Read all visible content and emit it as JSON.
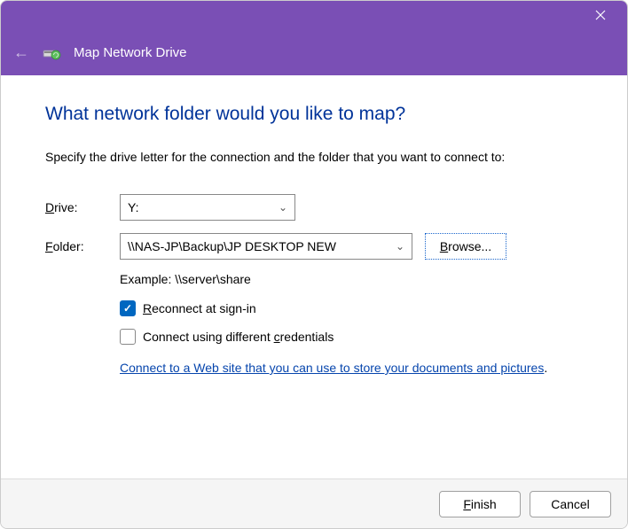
{
  "header": {
    "title": "Map Network Drive"
  },
  "main": {
    "heading": "What network folder would you like to map?",
    "subhead": "Specify the drive letter for the connection and the folder that you want to connect to:",
    "drive_label_pre": "D",
    "drive_label_u": "rive:",
    "drive_value": "Y:",
    "folder_label_pre": "F",
    "folder_label_u": "older:",
    "folder_value": "\\\\NAS-JP\\Backup\\JP DESKTOP NEW",
    "browse_u": "B",
    "browse_rest": "rowse...",
    "example": "Example: \\\\server\\share",
    "reconnect_u": "R",
    "reconnect_rest": "econnect at sign-in",
    "cred_pre": "Connect using different ",
    "cred_u": "c",
    "cred_rest": "redentials",
    "link": "Connect to a Web site that you can use to store your documents and pictures"
  },
  "footer": {
    "finish_u": "F",
    "finish_rest": "inish",
    "cancel": "Cancel"
  }
}
